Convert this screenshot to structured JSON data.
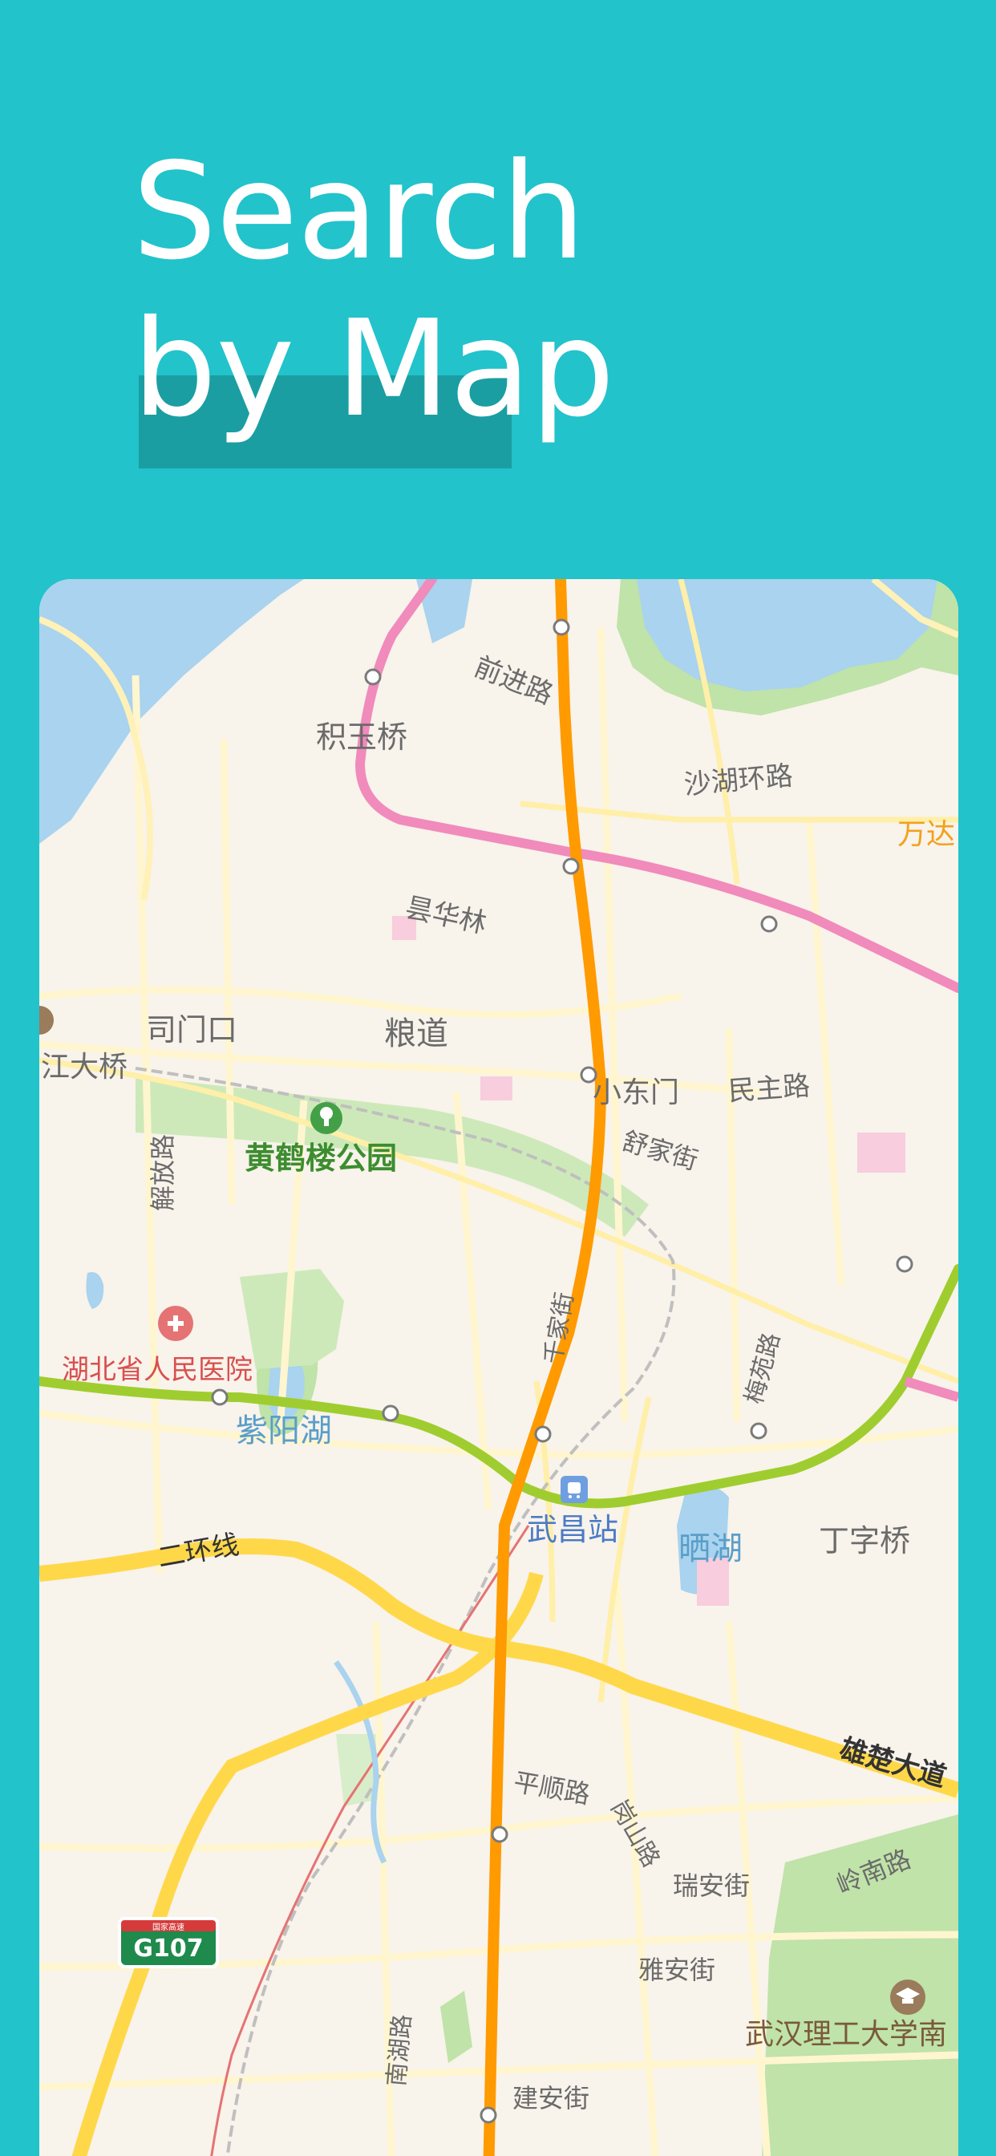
{
  "header": {
    "title_line1": "Search",
    "title_line2": "by Map"
  },
  "map": {
    "labels": {
      "qianjin_rd": "前进路",
      "jiyu_bridge": "积玉桥",
      "shahu_ring_rd": "沙湖环路",
      "wanda": "万达",
      "huahualin": "昙华林",
      "simenkou": "司门口",
      "liangdao": "粮道",
      "jiang_bridge": "江大桥",
      "xiaodongmen": "小东门",
      "minzhu_rd": "民主路",
      "shujia_st": "舒家街",
      "jiefang_rd": "解放路",
      "yellow_crane_park": "黄鹤楼公园",
      "qianjia_st": "千家街",
      "meiyuan_rd": "梅苑路",
      "hubei_hospital": "湖北省人民医院",
      "ziyang_lake": "紫阳湖",
      "wuchang_station": "武昌站",
      "shai_lake": "晒湖",
      "dingzi_bridge": "丁字桥",
      "second_ring": "二环线",
      "xiongchu_ave": "雄楚大道",
      "pingshun_rd": "平顺路",
      "gangshan_rd": "岗山路",
      "ruian_st": "瑞安街",
      "lingnan_rd": "岭南路",
      "highway_badge": "G107",
      "highway_badge_top": "国家高速",
      "yaan_st": "雅安街",
      "wut_university": "武汉理工大学南",
      "nanhu_rd": "南湖路",
      "jianan_st": "建安街"
    },
    "colors": {
      "land": "#F8F3EB",
      "water": "#A9D3EE",
      "green": "#BFE3A8",
      "metro_orange": "#FF9A00",
      "metro_pink": "#F08BBC",
      "metro_green": "#9FCD2F",
      "road_yellow": "#FFD84A",
      "minor_road": "#FFF0B8",
      "poi_pink": "#F8CDDD"
    }
  }
}
